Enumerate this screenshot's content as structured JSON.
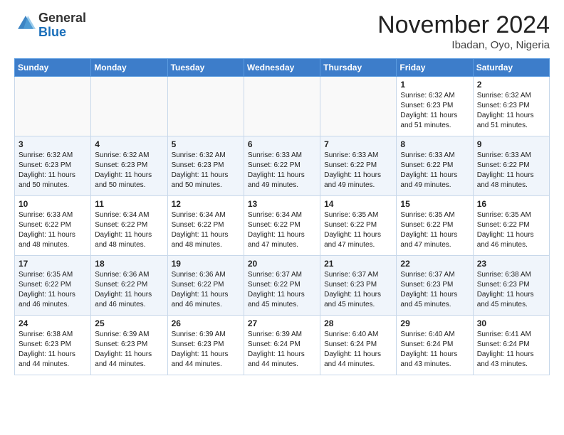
{
  "header": {
    "logo_general": "General",
    "logo_blue": "Blue",
    "month": "November 2024",
    "location": "Ibadan, Oyo, Nigeria"
  },
  "weekdays": [
    "Sunday",
    "Monday",
    "Tuesday",
    "Wednesday",
    "Thursday",
    "Friday",
    "Saturday"
  ],
  "weeks": [
    [
      {
        "day": "",
        "info": ""
      },
      {
        "day": "",
        "info": ""
      },
      {
        "day": "",
        "info": ""
      },
      {
        "day": "",
        "info": ""
      },
      {
        "day": "",
        "info": ""
      },
      {
        "day": "1",
        "info": "Sunrise: 6:32 AM\nSunset: 6:23 PM\nDaylight: 11 hours\nand 51 minutes."
      },
      {
        "day": "2",
        "info": "Sunrise: 6:32 AM\nSunset: 6:23 PM\nDaylight: 11 hours\nand 51 minutes."
      }
    ],
    [
      {
        "day": "3",
        "info": "Sunrise: 6:32 AM\nSunset: 6:23 PM\nDaylight: 11 hours\nand 50 minutes."
      },
      {
        "day": "4",
        "info": "Sunrise: 6:32 AM\nSunset: 6:23 PM\nDaylight: 11 hours\nand 50 minutes."
      },
      {
        "day": "5",
        "info": "Sunrise: 6:32 AM\nSunset: 6:23 PM\nDaylight: 11 hours\nand 50 minutes."
      },
      {
        "day": "6",
        "info": "Sunrise: 6:33 AM\nSunset: 6:22 PM\nDaylight: 11 hours\nand 49 minutes."
      },
      {
        "day": "7",
        "info": "Sunrise: 6:33 AM\nSunset: 6:22 PM\nDaylight: 11 hours\nand 49 minutes."
      },
      {
        "day": "8",
        "info": "Sunrise: 6:33 AM\nSunset: 6:22 PM\nDaylight: 11 hours\nand 49 minutes."
      },
      {
        "day": "9",
        "info": "Sunrise: 6:33 AM\nSunset: 6:22 PM\nDaylight: 11 hours\nand 48 minutes."
      }
    ],
    [
      {
        "day": "10",
        "info": "Sunrise: 6:33 AM\nSunset: 6:22 PM\nDaylight: 11 hours\nand 48 minutes."
      },
      {
        "day": "11",
        "info": "Sunrise: 6:34 AM\nSunset: 6:22 PM\nDaylight: 11 hours\nand 48 minutes."
      },
      {
        "day": "12",
        "info": "Sunrise: 6:34 AM\nSunset: 6:22 PM\nDaylight: 11 hours\nand 48 minutes."
      },
      {
        "day": "13",
        "info": "Sunrise: 6:34 AM\nSunset: 6:22 PM\nDaylight: 11 hours\nand 47 minutes."
      },
      {
        "day": "14",
        "info": "Sunrise: 6:35 AM\nSunset: 6:22 PM\nDaylight: 11 hours\nand 47 minutes."
      },
      {
        "day": "15",
        "info": "Sunrise: 6:35 AM\nSunset: 6:22 PM\nDaylight: 11 hours\nand 47 minutes."
      },
      {
        "day": "16",
        "info": "Sunrise: 6:35 AM\nSunset: 6:22 PM\nDaylight: 11 hours\nand 46 minutes."
      }
    ],
    [
      {
        "day": "17",
        "info": "Sunrise: 6:35 AM\nSunset: 6:22 PM\nDaylight: 11 hours\nand 46 minutes."
      },
      {
        "day": "18",
        "info": "Sunrise: 6:36 AM\nSunset: 6:22 PM\nDaylight: 11 hours\nand 46 minutes."
      },
      {
        "day": "19",
        "info": "Sunrise: 6:36 AM\nSunset: 6:22 PM\nDaylight: 11 hours\nand 46 minutes."
      },
      {
        "day": "20",
        "info": "Sunrise: 6:37 AM\nSunset: 6:22 PM\nDaylight: 11 hours\nand 45 minutes."
      },
      {
        "day": "21",
        "info": "Sunrise: 6:37 AM\nSunset: 6:23 PM\nDaylight: 11 hours\nand 45 minutes."
      },
      {
        "day": "22",
        "info": "Sunrise: 6:37 AM\nSunset: 6:23 PM\nDaylight: 11 hours\nand 45 minutes."
      },
      {
        "day": "23",
        "info": "Sunrise: 6:38 AM\nSunset: 6:23 PM\nDaylight: 11 hours\nand 45 minutes."
      }
    ],
    [
      {
        "day": "24",
        "info": "Sunrise: 6:38 AM\nSunset: 6:23 PM\nDaylight: 11 hours\nand 44 minutes."
      },
      {
        "day": "25",
        "info": "Sunrise: 6:39 AM\nSunset: 6:23 PM\nDaylight: 11 hours\nand 44 minutes."
      },
      {
        "day": "26",
        "info": "Sunrise: 6:39 AM\nSunset: 6:23 PM\nDaylight: 11 hours\nand 44 minutes."
      },
      {
        "day": "27",
        "info": "Sunrise: 6:39 AM\nSunset: 6:24 PM\nDaylight: 11 hours\nand 44 minutes."
      },
      {
        "day": "28",
        "info": "Sunrise: 6:40 AM\nSunset: 6:24 PM\nDaylight: 11 hours\nand 44 minutes."
      },
      {
        "day": "29",
        "info": "Sunrise: 6:40 AM\nSunset: 6:24 PM\nDaylight: 11 hours\nand 43 minutes."
      },
      {
        "day": "30",
        "info": "Sunrise: 6:41 AM\nSunset: 6:24 PM\nDaylight: 11 hours\nand 43 minutes."
      }
    ]
  ]
}
